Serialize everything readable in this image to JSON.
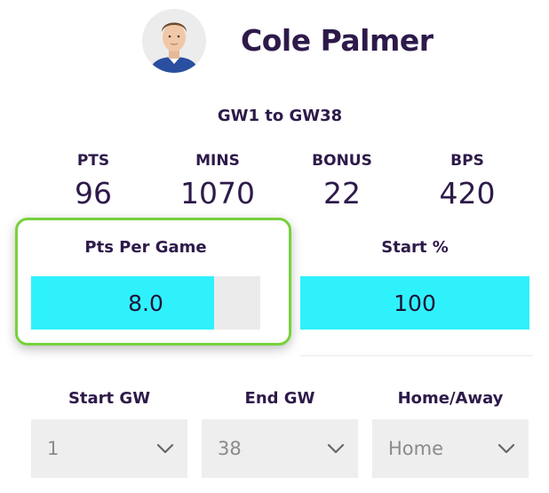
{
  "player": {
    "name": "Cole Palmer",
    "avatar_icon": "player-avatar-icon"
  },
  "range": "GW1 to GW38",
  "stats": [
    {
      "label": "PTS",
      "value": "96"
    },
    {
      "label": "MINS",
      "value": "1070"
    },
    {
      "label": "BONUS",
      "value": "22"
    },
    {
      "label": "BPS",
      "value": "420"
    }
  ],
  "bars": {
    "pts_per_game": {
      "label": "Pts Per Game",
      "value": "8.0",
      "fill_fraction": 0.8
    },
    "start_pct": {
      "label": "Start %",
      "value": "100",
      "fill_fraction": 1.0
    }
  },
  "filters": {
    "start_gw": {
      "label": "Start GW",
      "value": "1"
    },
    "end_gw": {
      "label": "End GW",
      "value": "38"
    },
    "home_away": {
      "label": "Home/Away",
      "value": "Home"
    }
  },
  "colors": {
    "bar_fill": "#2ff1fc",
    "bar_track": "#ebebeb",
    "highlight_border": "#76d13a",
    "text_primary": "#2d1a4a"
  }
}
